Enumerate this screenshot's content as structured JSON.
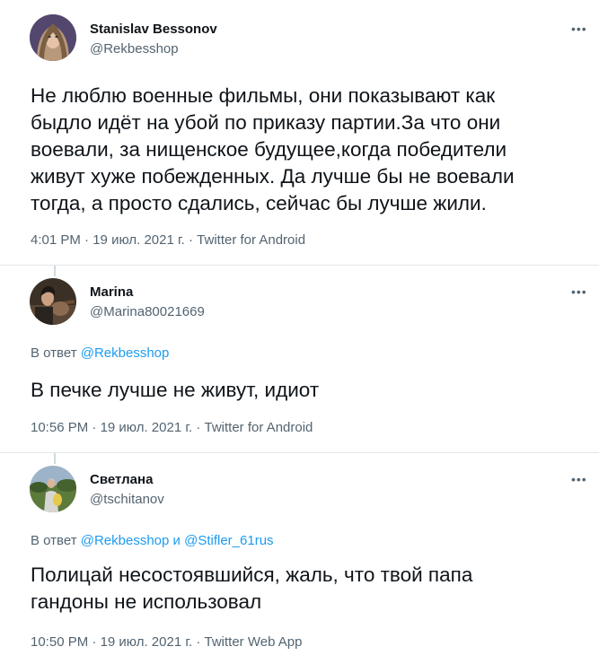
{
  "tweets": [
    {
      "name": "Stanislav Bessonov",
      "handle": "@Rekbesshop",
      "more": "•••",
      "lines": [
        "Не люблю военные фильмы, они показывают как",
        "быдло идёт на убой по приказу партии.За что они",
        "воевали, за нищенское будущее,когда победители",
        "живут хуже побежденных. Да лучше бы не воевали",
        "тогда, а просто сдались, сейчас бы лучше жили."
      ],
      "meta": {
        "time": "4:01 PM",
        "date": "19 июл. 2021 г.",
        "client": "Twitter for Android"
      }
    },
    {
      "name": "Marina",
      "handle": "@Marina80021669",
      "more": "•••",
      "reply_prefix": "В ответ",
      "reply_mentions": [
        "@Rekbesshop"
      ],
      "lines": [
        "В печке лучше не живут, идиот"
      ],
      "meta": {
        "time": "10:56 PM",
        "date": "19 июл. 2021 г.",
        "client": "Twitter for Android"
      }
    },
    {
      "name": "Светлана",
      "handle": "@tschitanov",
      "more": "•••",
      "reply_prefix": "В ответ",
      "reply_conj": "и",
      "reply_mentions": [
        "@Rekbesshop",
        "@Stifler_61rus"
      ],
      "lines": [
        "Полицай несостоявшийся, жаль, что твой папа",
        "гандоны не использовал"
      ],
      "meta": {
        "time": "10:50 PM",
        "date": "19 июл. 2021 г.",
        "client": "Twitter Web App"
      }
    }
  ],
  "meta_separator": "·",
  "colors": {
    "text": "#0f1419",
    "secondary": "#536471",
    "mention": "#1d9bf0",
    "divider": "#e3e7ea",
    "thread_line": "#cfd9de"
  }
}
